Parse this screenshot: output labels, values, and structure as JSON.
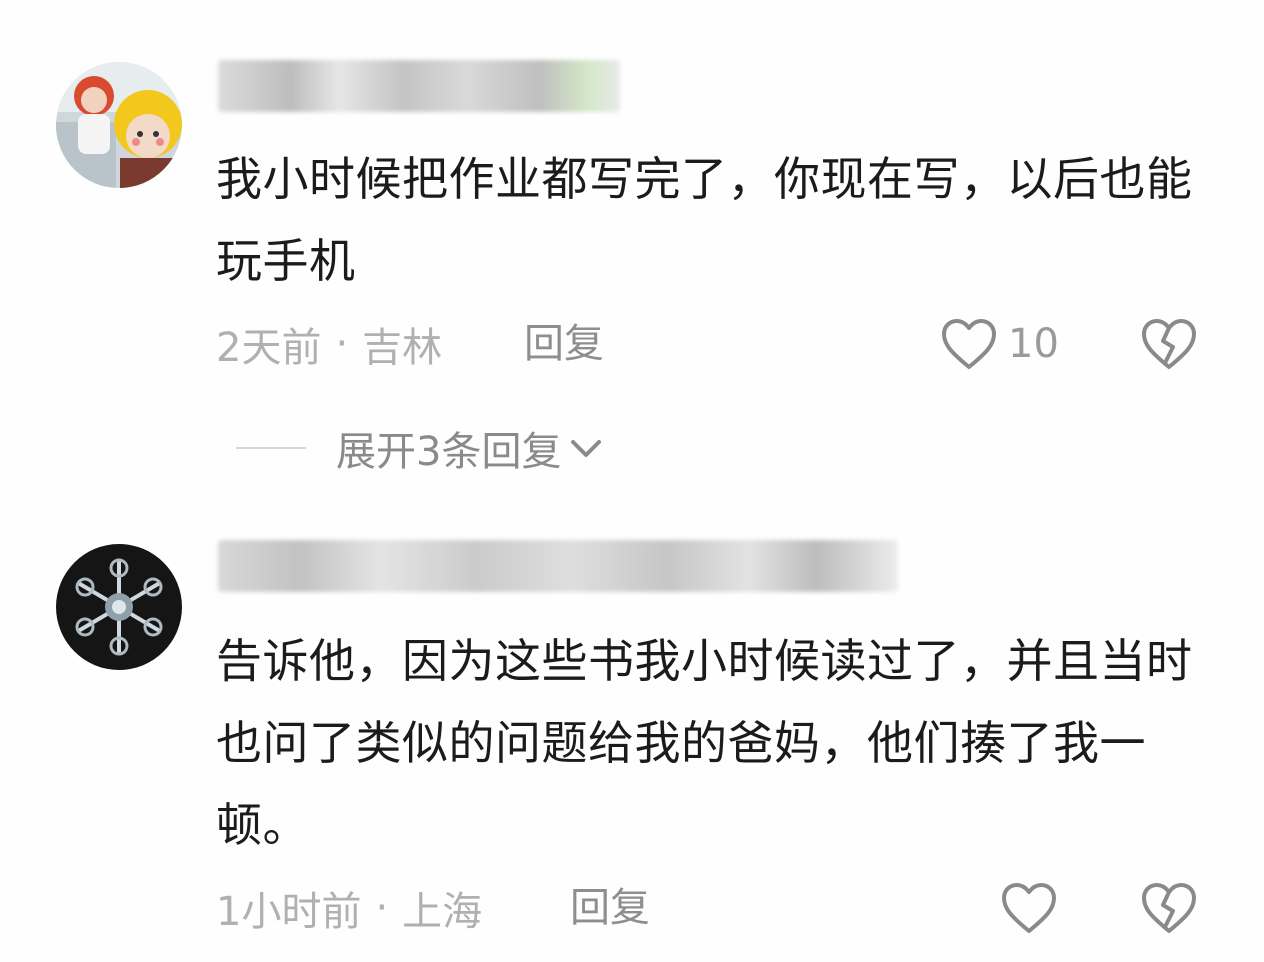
{
  "comments": [
    {
      "avatar_icon": "avatar-photo-icon",
      "text": "我小时候把作业都写完了，你现在写，以后也能玩手机",
      "time": "2天前",
      "location": "吉林",
      "reply_label": "回复",
      "like_count": "10",
      "expand_label": "展开3条回复"
    },
    {
      "avatar_icon": "snowflake-avatar-icon",
      "text": "告诉他，因为这些书我小时候读过了，并且当时也问了类似的问题给我的爸妈，他们揍了我一顿。",
      "time": "1小时前",
      "location": "上海",
      "reply_label": "回复",
      "like_count": ""
    }
  ],
  "separator": "·",
  "colors": {
    "text": "#1b1b1b",
    "meta": "#b0b0b0",
    "reply": "#8e8e8e",
    "icon_stroke": "#8a8a8a",
    "background": "#fefefe"
  }
}
